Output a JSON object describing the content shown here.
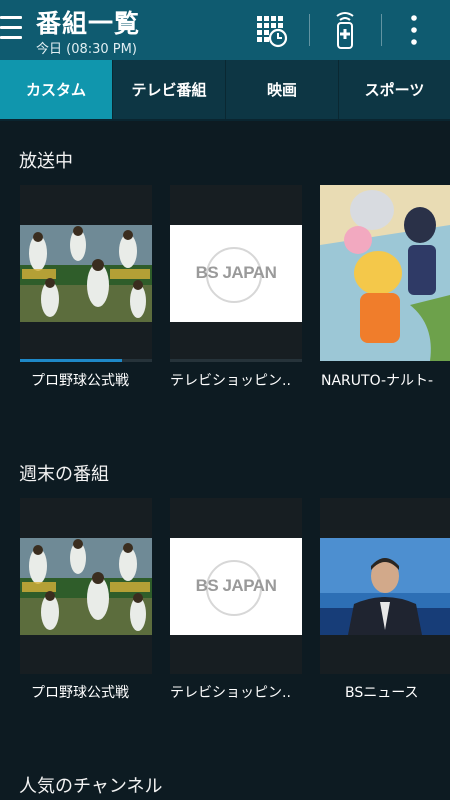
{
  "appbar": {
    "title": "番組一覧",
    "subtitle": "今日 (08:30 PM)",
    "icons": [
      "menu-icon",
      "schedule-grid-clock-icon",
      "remote-control-icon",
      "overflow-menu-icon"
    ]
  },
  "tabs": [
    {
      "label": "カスタム",
      "active": true
    },
    {
      "label": "テレビ番組",
      "active": false
    },
    {
      "label": "映画",
      "active": false
    },
    {
      "label": "スポーツ",
      "active": false
    }
  ],
  "sections": [
    {
      "title": "放送中",
      "cards": [
        {
          "label": "プロ野球公式戦",
          "thumb": "baseball-players-collage",
          "progress": 0.77
        },
        {
          "label": "テレビショッピン..",
          "thumb": "bs-japan-logo",
          "logo_text": "BS JAPAN",
          "progress": 0
        },
        {
          "label": "NARUTO-ナルト-",
          "thumb": "naruto-anime-art",
          "progress": 0
        }
      ]
    },
    {
      "title": "週末の番組",
      "cards": [
        {
          "label": "プロ野球公式戦",
          "thumb": "baseball-players-collage"
        },
        {
          "label": "テレビショッピン..",
          "thumb": "bs-japan-logo",
          "logo_text": "BS JAPAN"
        },
        {
          "label": "BSニュース",
          "thumb": "news-anchor"
        }
      ]
    },
    {
      "title": "人気のチャンネル",
      "cards": []
    }
  ],
  "colors": {
    "appbar": "#0f5b70",
    "tab_active": "#1096ad",
    "tab_inactive": "#0d3644",
    "background": "#0d1b22",
    "progress": "#1e88c7"
  }
}
